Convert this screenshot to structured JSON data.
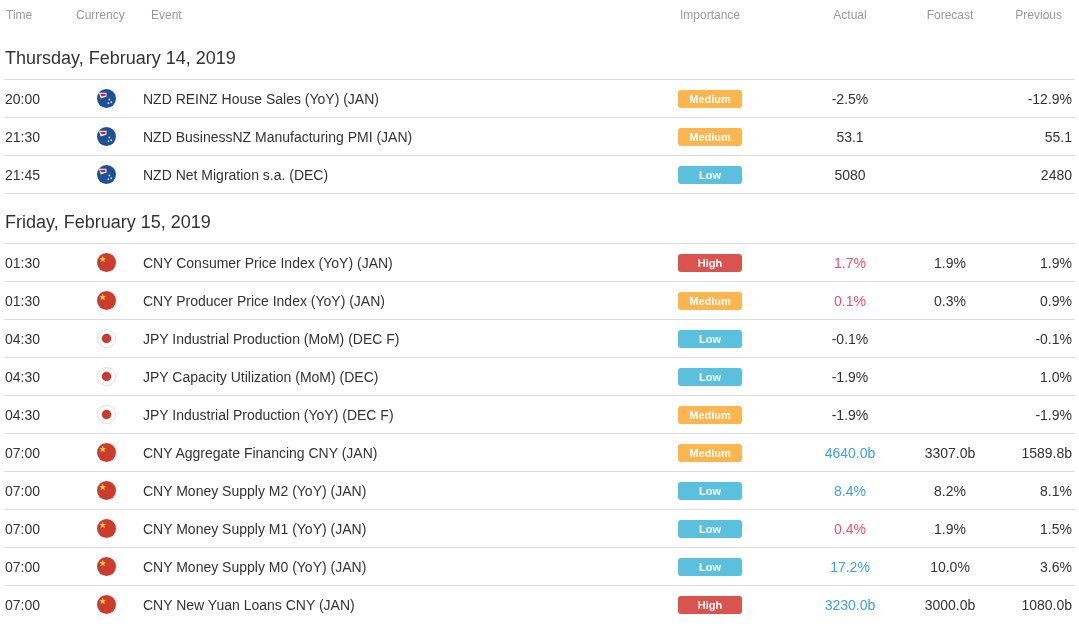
{
  "columns": [
    "Time",
    "Currency",
    "Event",
    "Importance",
    "Actual",
    "Forecast",
    "Previous"
  ],
  "days": [
    {
      "title": "Thursday, February 14, 2019",
      "events": [
        {
          "time": "20:00",
          "kind": "nz",
          "event": "NZD REINZ House Sales (YoY) (JAN)",
          "importance": {
            "label": "Medium",
            "color": "#fdb64f"
          },
          "actual": {
            "text": "-2.5%",
            "color": "#333333"
          },
          "previous": "-12.9%"
        },
        {
          "time": "21:30",
          "kind": "nz",
          "event": "NZD BusinessNZ Manufacturing PMI (JAN)",
          "importance": {
            "label": "Medium",
            "color": "#fdb64f"
          },
          "actual": {
            "text": "53.1",
            "color": "#333333"
          },
          "previous": "55.1"
        },
        {
          "time": "21:45",
          "kind": "nz",
          "event": "NZD Net Migration s.a. (DEC)",
          "importance": {
            "label": "Low",
            "color": "#5bc0de"
          },
          "actual": {
            "text": "5080",
            "color": "#333333"
          },
          "previous": "2480"
        }
      ]
    },
    {
      "title": "Friday, February 15, 2019",
      "events": [
        {
          "time": "01:30",
          "kind": "cn",
          "event": "CNY Consumer Price Index (YoY) (JAN)",
          "importance": {
            "label": "High",
            "color": "#d9534f"
          },
          "actual": {
            "text": "1.7%",
            "color": "#f0506e"
          },
          "forecast": "1.9%",
          "previous": "1.9%"
        },
        {
          "time": "01:30",
          "kind": "cn",
          "event": "CNY Producer Price Index (YoY) (JAN)",
          "importance": {
            "label": "Medium",
            "color": "#fdb64f"
          },
          "actual": {
            "text": "0.1%",
            "color": "#f0506e"
          },
          "forecast": "0.3%",
          "previous": "0.9%"
        },
        {
          "time": "04:30",
          "kind": "jp",
          "event": "JPY Industrial Production (MoM) (DEC F)",
          "importance": {
            "label": "Low",
            "color": "#5bc0de"
          },
          "actual": {
            "text": "-0.1%",
            "color": "#333333"
          },
          "previous": "-0.1%"
        },
        {
          "time": "04:30",
          "kind": "jp",
          "event": "JPY Capacity Utilization (MoM) (DEC)",
          "importance": {
            "label": "Low",
            "color": "#5bc0de"
          },
          "actual": {
            "text": "-1.9%",
            "color": "#333333"
          },
          "previous": "1.0%"
        },
        {
          "time": "04:30",
          "kind": "jp",
          "event": "JPY Industrial Production (YoY) (DEC F)",
          "importance": {
            "label": "Medium",
            "color": "#fdb64f"
          },
          "actual": {
            "text": "-1.9%",
            "color": "#333333"
          },
          "previous": "-1.9%"
        },
        {
          "time": "07:00",
          "kind": "cn",
          "event": "CNY Aggregate Financing CNY (JAN)",
          "importance": {
            "label": "Medium",
            "color": "#fdb64f"
          },
          "actual": {
            "text": "4640.0b",
            "color": "#3fa0e0"
          },
          "forecast": "3307.0b",
          "previous": "1589.8b"
        },
        {
          "time": "07:00",
          "kind": "cn",
          "event": "CNY Money Supply M2 (YoY) (JAN)",
          "importance": {
            "label": "Low",
            "color": "#5bc0de"
          },
          "actual": {
            "text": "8.4%",
            "color": "#3fa0e0"
          },
          "forecast": "8.2%",
          "previous": "8.1%"
        },
        {
          "time": "07:00",
          "kind": "cn",
          "event": "CNY Money Supply M1 (YoY) (JAN)",
          "importance": {
            "label": "Low",
            "color": "#5bc0de"
          },
          "actual": {
            "text": "0.4%",
            "color": "#f0506e"
          },
          "forecast": "1.9%",
          "previous": "1.5%"
        },
        {
          "time": "07:00",
          "kind": "cn",
          "event": "CNY Money Supply M0 (YoY) (JAN)",
          "importance": {
            "label": "Low",
            "color": "#5bc0de"
          },
          "actual": {
            "text": "17.2%",
            "color": "#3fa0e0"
          },
          "forecast": "10.0%",
          "previous": "3.6%"
        },
        {
          "time": "07:00",
          "kind": "cn",
          "event": "CNY New Yuan Loans CNY (JAN)",
          "importance": {
            "label": "High",
            "color": "#d9534f"
          },
          "actual": {
            "text": "3230.0b",
            "color": "#3fa0e0"
          },
          "forecast": "3000.0b",
          "previous": "1080.0b"
        }
      ]
    }
  ]
}
